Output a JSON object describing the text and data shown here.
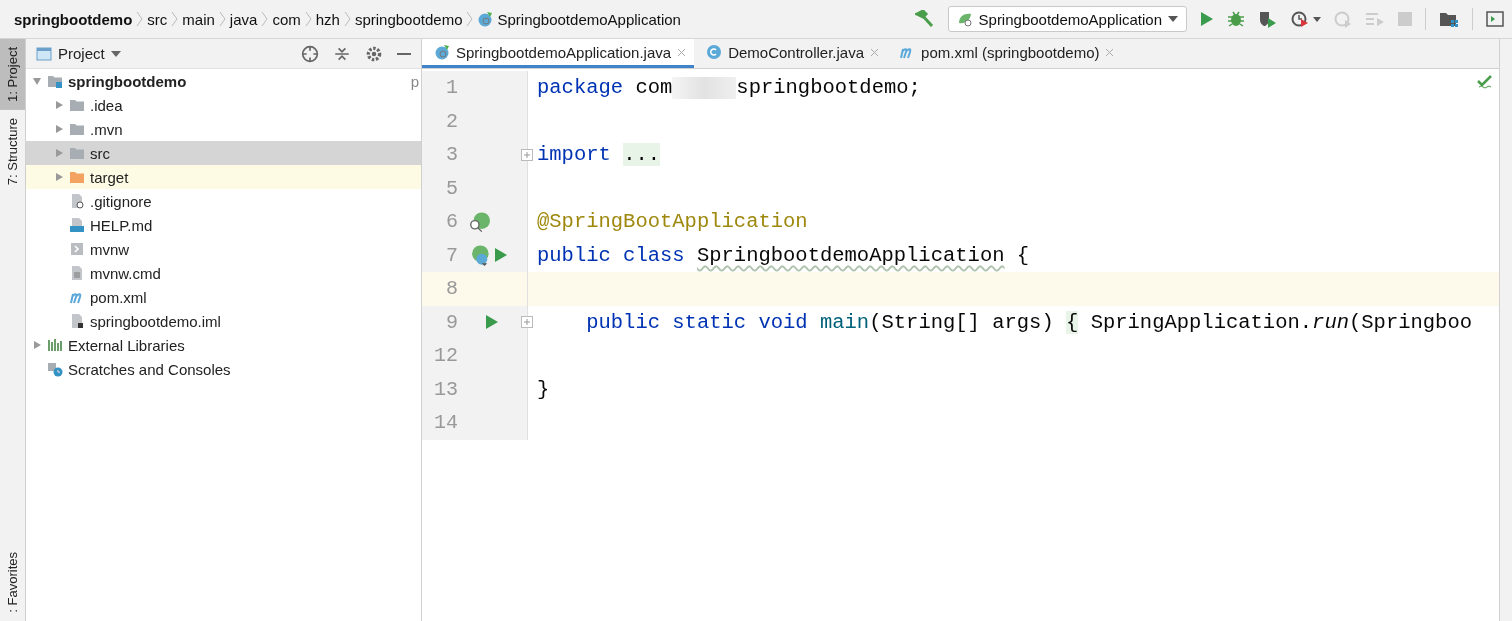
{
  "breadcrumbs": [
    {
      "label": "springbootdemo",
      "kind": "project"
    },
    {
      "label": "src",
      "kind": "folder"
    },
    {
      "label": "main",
      "kind": "folder"
    },
    {
      "label": "java",
      "kind": "folder"
    },
    {
      "label": "com",
      "kind": "folder"
    },
    {
      "label": "hzh",
      "kind": "folder"
    },
    {
      "label": "springbootdemo",
      "kind": "folder"
    },
    {
      "label": "SpringbootdemoApplication",
      "kind": "class"
    }
  ],
  "toolbar": {
    "run_config": "SpringbootdemoApplication"
  },
  "side_tabs_top": [
    {
      "label": "1: Project",
      "selected": true
    },
    {
      "label": "7: Structure",
      "selected": false
    }
  ],
  "side_tabs_bottom": [
    {
      "label": ": Favorites",
      "selected": false
    }
  ],
  "project_panel": {
    "title": "Project",
    "tree": [
      {
        "label": "springbootdemo",
        "kind": "module",
        "expanded": true,
        "selected": false,
        "excluded": false,
        "trailing": "p",
        "children": [
          {
            "label": ".idea",
            "kind": "folder",
            "expanded": false,
            "selected": false,
            "excluded": false
          },
          {
            "label": ".mvn",
            "kind": "folder",
            "expanded": false,
            "selected": false,
            "excluded": false
          },
          {
            "label": "src",
            "kind": "folder",
            "expanded": false,
            "selected": true,
            "excluded": false
          },
          {
            "label": "target",
            "kind": "folder",
            "expanded": false,
            "selected": false,
            "excluded": true
          },
          {
            "label": ".gitignore",
            "kind": "ignore-file",
            "selected": false,
            "excluded": false
          },
          {
            "label": "HELP.md",
            "kind": "markdown",
            "selected": false,
            "excluded": false
          },
          {
            "label": "mvnw",
            "kind": "script",
            "selected": false,
            "excluded": false
          },
          {
            "label": "mvnw.cmd",
            "kind": "text-file",
            "selected": false,
            "excluded": false
          },
          {
            "label": "pom.xml",
            "kind": "maven",
            "selected": false,
            "excluded": false
          },
          {
            "label": "springbootdemo.iml",
            "kind": "module-file",
            "selected": false,
            "excluded": false
          }
        ]
      },
      {
        "label": "External Libraries",
        "kind": "libraries",
        "expanded": false,
        "selected": false,
        "excluded": false
      },
      {
        "label": "Scratches and Consoles",
        "kind": "scratches",
        "selected": false,
        "excluded": false
      }
    ]
  },
  "editor_tabs": [
    {
      "label": "SpringbootdemoApplication.java",
      "kind": "spring-class",
      "selected": true
    },
    {
      "label": "DemoController.java",
      "kind": "class",
      "selected": false
    },
    {
      "label": "pom.xml (springbootdemo)",
      "kind": "maven",
      "selected": false
    }
  ],
  "code_lines": [
    {
      "number": "1",
      "current": false,
      "fold": false,
      "tokens": [
        {
          "kind": "keyword",
          "text": "package"
        },
        {
          "kind": "plain",
          "text": " com"
        },
        {
          "kind": "blurred"
        },
        {
          "kind": "plain",
          "text": "springbootdemo;"
        }
      ]
    },
    {
      "number": "2",
      "current": false,
      "fold": false
    },
    {
      "number": "3",
      "current": false,
      "fold": true,
      "tokens": [
        {
          "kind": "keyword",
          "text": "import "
        },
        {
          "kind": "folded",
          "text": "..."
        }
      ]
    },
    {
      "number": "5",
      "current": false,
      "fold": false
    },
    {
      "number": "6",
      "current": false,
      "fold": false,
      "gutter": [
        {
          "kind": "bean-search"
        }
      ],
      "tokens": [
        {
          "kind": "annotation",
          "text": "@SpringBootApplication"
        }
      ]
    },
    {
      "number": "7",
      "current": false,
      "fold": false,
      "gutter": [
        {
          "kind": "bean-class"
        },
        {
          "kind": "run"
        }
      ],
      "tokens": [
        {
          "kind": "keyword",
          "text": "public class "
        },
        {
          "kind": "typo",
          "text": "SpringbootdemoApplication"
        },
        {
          "kind": "plain",
          "text": " {"
        }
      ]
    },
    {
      "number": "8",
      "current": true,
      "fold": false
    },
    {
      "number": "9",
      "current": false,
      "fold": true,
      "gutter": [
        {
          "kind": "run"
        }
      ],
      "tokens": [
        {
          "kind": "keyword",
          "text": "    public static void "
        },
        {
          "kind": "method",
          "text": "main"
        },
        {
          "kind": "plain",
          "text": "(String[] args) "
        },
        {
          "kind": "folded",
          "text": "{"
        },
        {
          "kind": "plain",
          "text": " SpringApplication."
        },
        {
          "kind": "italic",
          "text": "run"
        },
        {
          "kind": "plain",
          "text": "(Springboo"
        }
      ]
    },
    {
      "number": "12",
      "current": false,
      "fold": false
    },
    {
      "number": "13",
      "current": false,
      "fold": false,
      "tokens": [
        {
          "kind": "plain",
          "text": "}"
        }
      ]
    },
    {
      "number": "14",
      "current": false,
      "fold": false
    }
  ]
}
